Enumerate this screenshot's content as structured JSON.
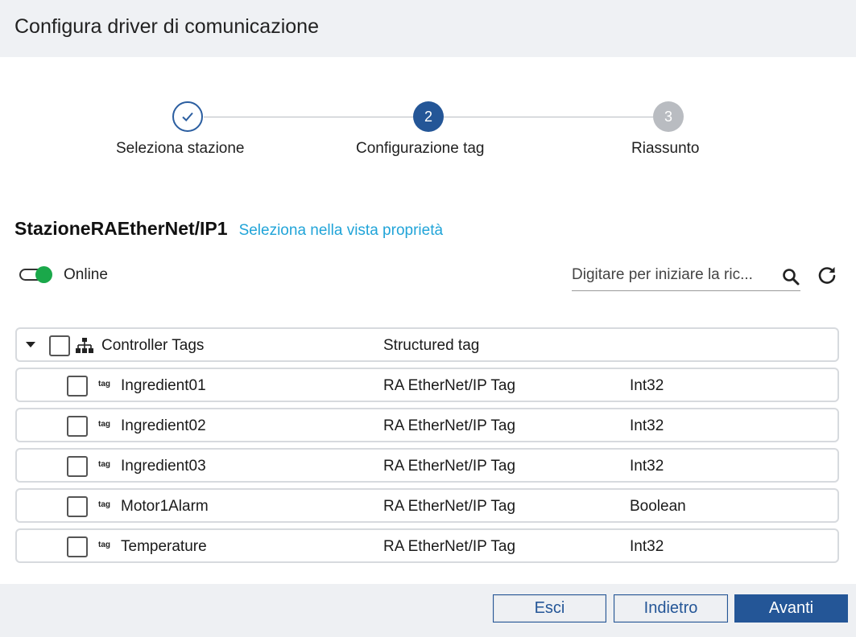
{
  "dialog": {
    "title": "Configura driver di comunicazione"
  },
  "stepper": {
    "steps": [
      {
        "number": "",
        "label": "Seleziona stazione",
        "state": "done"
      },
      {
        "number": "2",
        "label": "Configurazione tag",
        "state": "active"
      },
      {
        "number": "3",
        "label": "Riassunto",
        "state": "todo"
      }
    ]
  },
  "station": {
    "name": "StazioneRAEtherNet/IP1",
    "link": "Seleziona nella vista proprietà"
  },
  "online": {
    "label": "Online",
    "enabled": true
  },
  "search": {
    "placeholder": "Digitare per iniziare la ric..."
  },
  "tree": {
    "root": {
      "name": "Controller Tags",
      "type": "Structured tag"
    },
    "items": [
      {
        "name": "Ingredient01",
        "type": "RA EtherNet/IP Tag",
        "datatype": "Int32"
      },
      {
        "name": "Ingredient02",
        "type": "RA EtherNet/IP Tag",
        "datatype": "Int32"
      },
      {
        "name": "Ingredient03",
        "type": "RA EtherNet/IP Tag",
        "datatype": "Int32"
      },
      {
        "name": "Motor1Alarm",
        "type": "RA EtherNet/IP Tag",
        "datatype": "Boolean"
      },
      {
        "name": "Temperature",
        "type": "RA EtherNet/IP Tag",
        "datatype": "Int32"
      }
    ],
    "tag_icon_text": "tag"
  },
  "footer": {
    "exit": "Esci",
    "back": "Indietro",
    "next": "Avanti"
  },
  "colors": {
    "primary": "#245697",
    "link": "#21a4d8",
    "online": "#1aa84a",
    "step_todo": "#b9bcc1"
  }
}
